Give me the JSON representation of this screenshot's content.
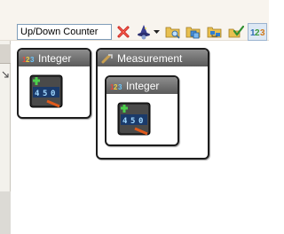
{
  "toolbar": {
    "name_field_value": "Up/Down Counter",
    "icons": [
      "delete-icon",
      "wizard-icon",
      "dropdown-arrow-icon",
      "folder-search-icon",
      "copy-folder-icon",
      "network-folder-icon",
      "check-folder-icon",
      "numeric-icon"
    ]
  },
  "blocks": {
    "integer_outer": {
      "title": "Integer",
      "icon": "integer-type-icon",
      "content_icon": "counter-display-icon"
    },
    "measurement": {
      "title": "Measurement",
      "icon": "measurement-tool-icon"
    },
    "integer_inner": {
      "title": "Integer",
      "icon": "integer-type-icon",
      "content_icon": "counter-display-icon"
    }
  },
  "colors": {
    "title_bar": "#6e6e6e",
    "block_border": "#1c1c1c",
    "toolbar_bg": "#f8f4ee",
    "delete_red": "#cc2222",
    "folder_yellow": "#e8c050"
  }
}
